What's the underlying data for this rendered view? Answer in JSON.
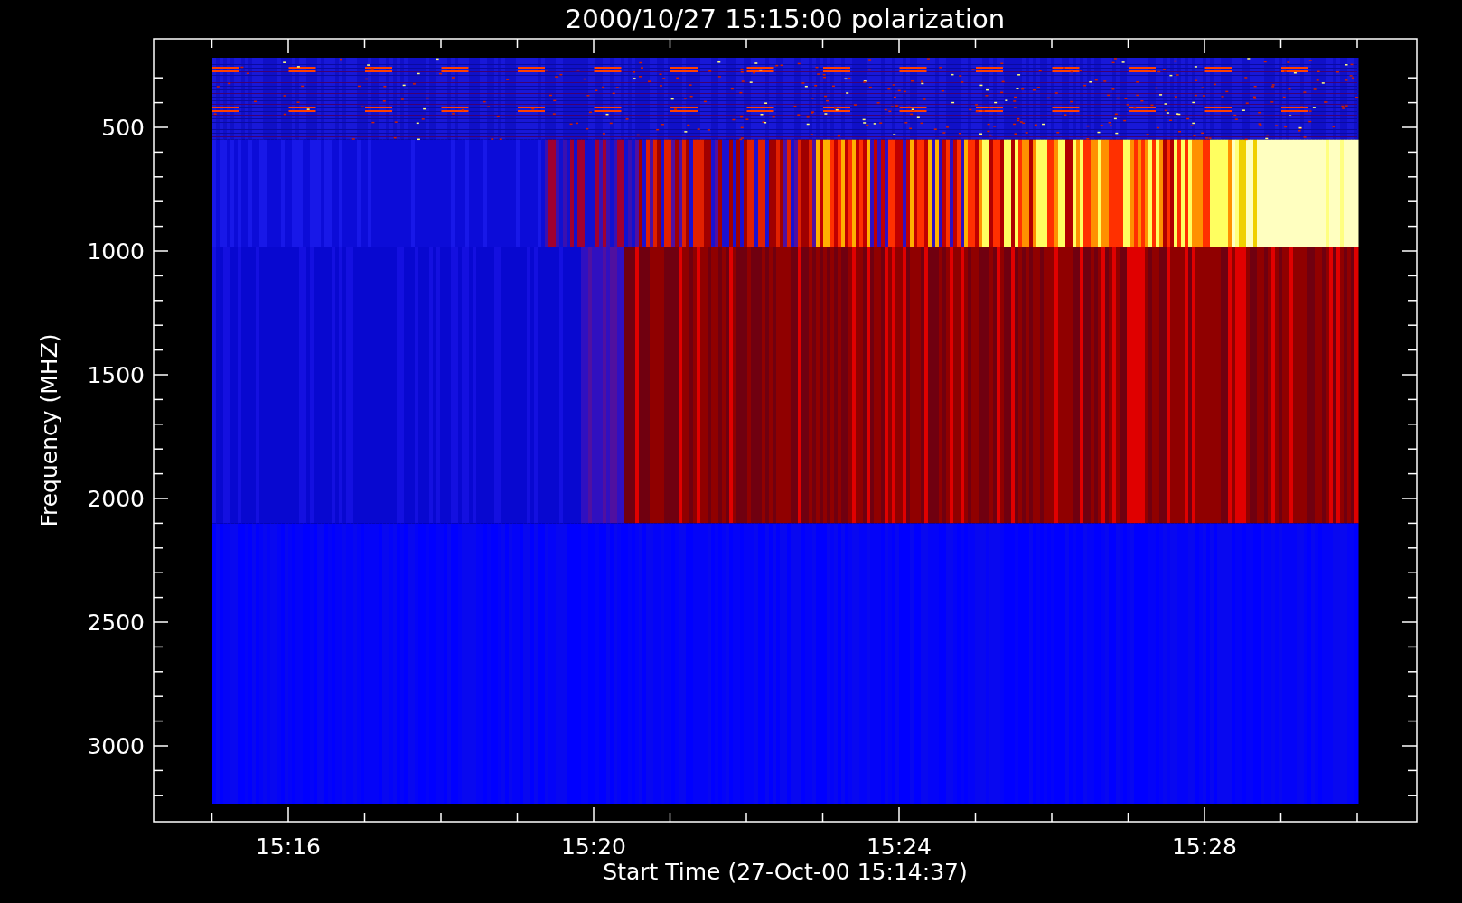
{
  "chart": {
    "title": "2000/10/27 15:15:00 polarization",
    "xlabel": "Start Time (27-Oct-00 15:14:37)",
    "ylabel": "Frequency (MHZ)",
    "xticks": [
      "15:16",
      "15:20",
      "15:24",
      "15:28"
    ],
    "yticks": [
      "500",
      "1000",
      "1500",
      "2000",
      "2500",
      "3000"
    ]
  }
}
